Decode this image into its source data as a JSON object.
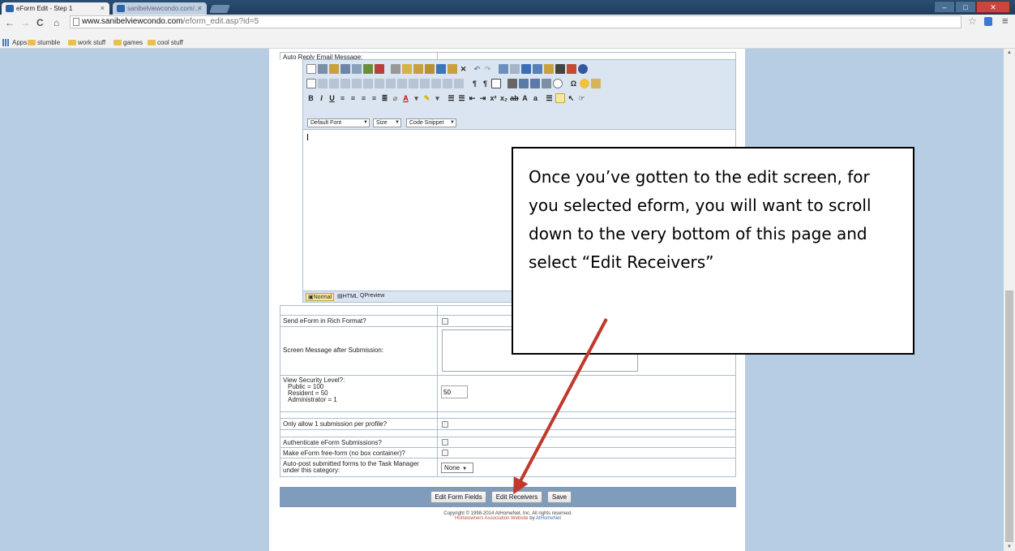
{
  "browser": {
    "tabs": [
      {
        "label": "eForm Edit - Step 1",
        "active": true
      },
      {
        "label": "sanibelviewcondo.com/...",
        "active": false
      }
    ],
    "url_host": "www.sanibelviewcondo.com",
    "url_path": "/eform_edit.asp?id=5",
    "bookmarks": [
      "Apps",
      "stumble",
      "work stuff",
      "games",
      "cool stuff"
    ]
  },
  "form": {
    "auto_reply_label": "Auto Reply Email Message:",
    "font_select": "Default Font",
    "size_select": "Size",
    "snippet_select": "Code Snippet",
    "modes": {
      "normal": "Normal",
      "html": "HTML",
      "preview": "Preview"
    },
    "rich_format_label": "Send eForm in Rich Format?",
    "screen_message_label": "Screen Message after Submission:",
    "security_label": "View Security Level?:",
    "security_public": "Public = 100",
    "security_resident": "Resident = 50",
    "security_admin": "Administrator = 1",
    "security_value": "50",
    "one_submission_label": "Only allow 1 submission per profile?",
    "authenticate_label": "Authenticate eForm Submissions?",
    "freeform_label": "Make eForm free-form (no box container)?",
    "autopost_label": "Auto-post submitted forms to the Task Manager under this category:",
    "autopost_value": "None"
  },
  "buttons": {
    "edit_form_fields": "Edit Form Fields",
    "edit_receivers": "Edit Receivers",
    "save": "Save"
  },
  "footer": {
    "copyright": "Copyright © 1998-2014 AtHomeNet, Inc. All rights reserved.",
    "website_link": "Homeowners Association Website",
    "by": "by",
    "athomenet_link": "AtHomeNet"
  },
  "callout": {
    "text": "Once you’ve gotten to the edit screen, for you selected eform, you will want to scroll down to the very bottom of this page and select “Edit Receivers”"
  },
  "colors": {
    "page_background": "#b7cde4",
    "button_bar": "#7f9cbd",
    "editor_toolbar": "#dbe5f1",
    "arrow": "#c0392b"
  }
}
